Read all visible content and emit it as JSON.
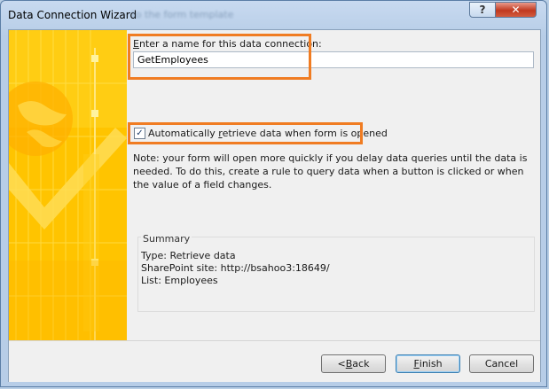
{
  "window": {
    "title": "Data Connection Wizard",
    "ghost_text": "- to the form template",
    "help_label": "?",
    "close_label": "✕"
  },
  "form": {
    "name_label_first": "E",
    "name_label_rest": "nter a name for this data connection:",
    "name_value": "GetEmployees",
    "checkbox_checked": true,
    "checkbox_mark": "✓",
    "checkbox_label_pre": "Automatically ",
    "checkbox_label_accel": "r",
    "checkbox_label_post": "etrieve data when form is opened",
    "note": "Note: your form will open more quickly if you delay data queries until the data is needed. To do this, create a rule to query data when a button is clicked or when the value of a field changes."
  },
  "summary": {
    "title": "Summary",
    "lines": [
      "Type: Retrieve data",
      "SharePoint site: http://bsahoo3:18649/",
      "List: Employees"
    ]
  },
  "buttons": {
    "back_prefix": "< ",
    "back_accel": "B",
    "back_rest": "ack",
    "finish_accel": "F",
    "finish_rest": "inish",
    "cancel": "Cancel"
  },
  "colors": {
    "highlight": "#f07c22",
    "banner": "#ffc800"
  }
}
